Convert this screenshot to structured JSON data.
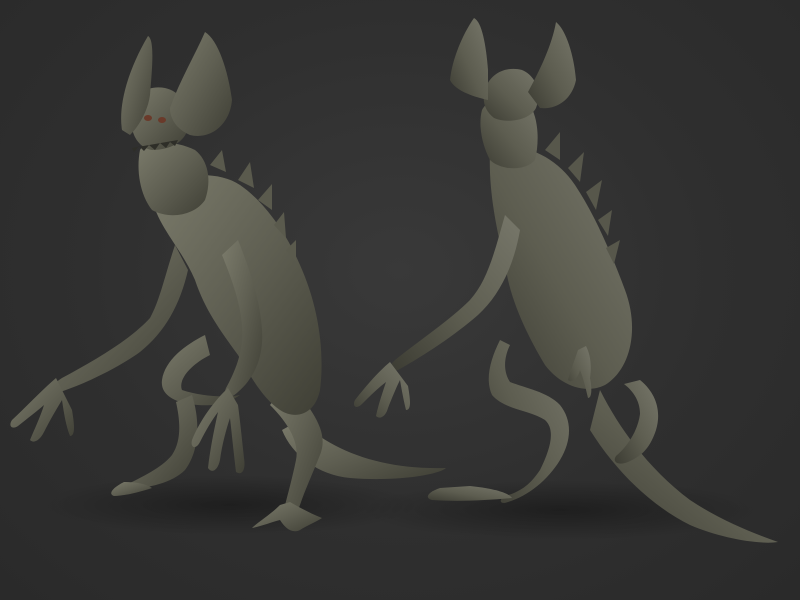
{
  "scene": {
    "background_color": "#303030",
    "clay_color": "#5f5f52",
    "clay_highlight": "#7b7b6b",
    "clay_shadow": "#3f3f35",
    "eye_color": "#6a3a2a",
    "views": [
      {
        "name": "front-three-quarter"
      },
      {
        "name": "back-three-quarter"
      }
    ]
  }
}
